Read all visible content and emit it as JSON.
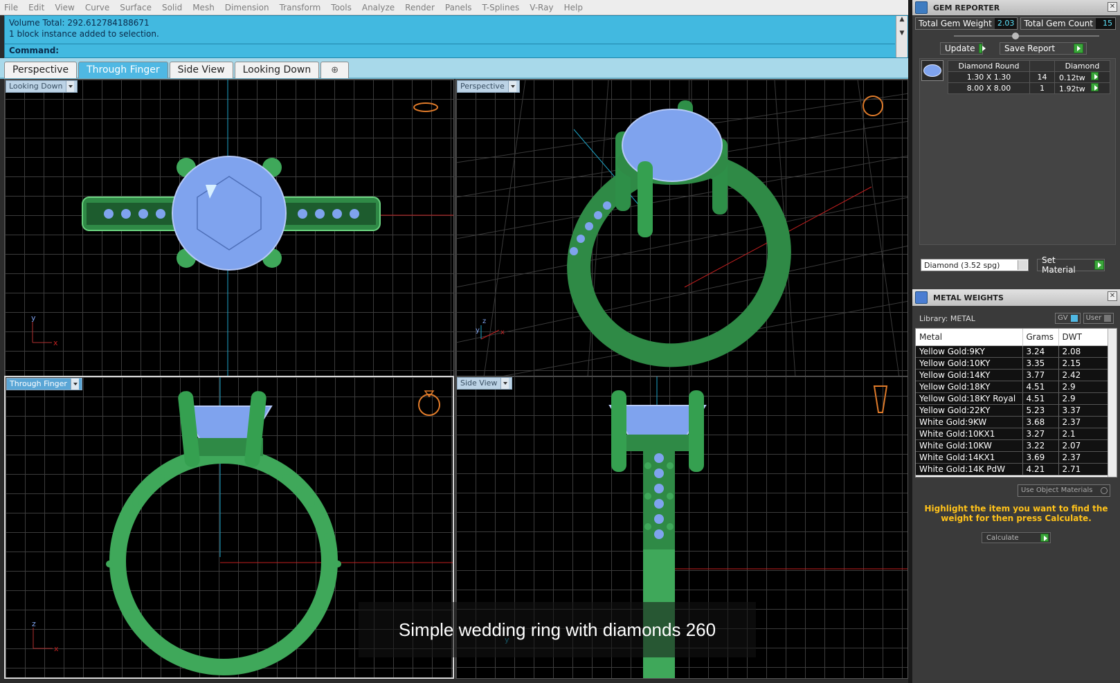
{
  "menu": [
    "File",
    "Edit",
    "View",
    "Curve",
    "Surface",
    "Solid",
    "Mesh",
    "Dimension",
    "Transform",
    "Tools",
    "Analyze",
    "Render",
    "Panels",
    "T-Splines",
    "V-Ray",
    "Help"
  ],
  "command": {
    "history_line1": "Volume Total: 292.612784188671",
    "history_line2": "1 block instance added to selection.",
    "prompt": "Command:"
  },
  "tabs": [
    "Perspective",
    "Through Finger",
    "Side View",
    "Looking Down"
  ],
  "tab_add": "⊕",
  "viewports": {
    "top_left": "Looking Down",
    "top_right": "Perspective",
    "bottom_left": "Through Finger",
    "bottom_right": "Side View"
  },
  "axes": {
    "x": "x",
    "y": "y",
    "z": "z"
  },
  "gem_reporter": {
    "title": "GEM REPORTER",
    "total_weight_label": "Total Gem Weight",
    "total_weight": "2.03",
    "total_count_label": "Total Gem Count",
    "total_count": "15",
    "update": "Update",
    "save_report": "Save Report",
    "headers": [
      "Diamond Round",
      "",
      "Diamond"
    ],
    "rows": [
      [
        "1.30 X 1.30",
        "14",
        "0.12tw"
      ],
      [
        "8.00 X 8.00",
        "1",
        "1.92tw"
      ]
    ],
    "material_select": "Diamond    (3.52 spg)",
    "set_material": "Set Material"
  },
  "metal_weights": {
    "title": "METAL WEIGHTS",
    "library": "Library: METAL",
    "gv": "GV",
    "user": "User",
    "headers": [
      "Metal",
      "Grams",
      "DWT"
    ],
    "rows": [
      [
        "Yellow Gold:9KY",
        "3.24",
        "2.08"
      ],
      [
        "Yellow Gold:10KY",
        "3.35",
        "2.15"
      ],
      [
        "Yellow Gold:14KY",
        "3.77",
        "2.42"
      ],
      [
        "Yellow Gold:18KY",
        "4.51",
        "2.9"
      ],
      [
        "Yellow Gold:18KY Royal",
        "4.51",
        "2.9"
      ],
      [
        "Yellow Gold:22KY",
        "5.23",
        "3.37"
      ],
      [
        "White Gold:9KW",
        "3.68",
        "2.37"
      ],
      [
        "White Gold:10KX1",
        "3.27",
        "2.1"
      ],
      [
        "White Gold:10KW",
        "3.22",
        "2.07"
      ],
      [
        "White Gold:14KX1",
        "3.69",
        "2.37"
      ],
      [
        "White Gold:14K PdW",
        "4.21",
        "2.71"
      ]
    ],
    "use_object_materials": "Use Object Materials",
    "hint": "Highlight the item you want to find the weight for then press Calculate.",
    "calculate": "Calculate"
  },
  "caption": "Simple wedding ring with diamonds 260",
  "colors": {
    "command_bg": "#42b9e0",
    "ring_green": "#3fa85a",
    "gem_blue": "#7fa3ee",
    "hint_yellow": "#ffc21a",
    "axis_red": "#c32020",
    "axis_cyan": "#1ea5c8"
  }
}
